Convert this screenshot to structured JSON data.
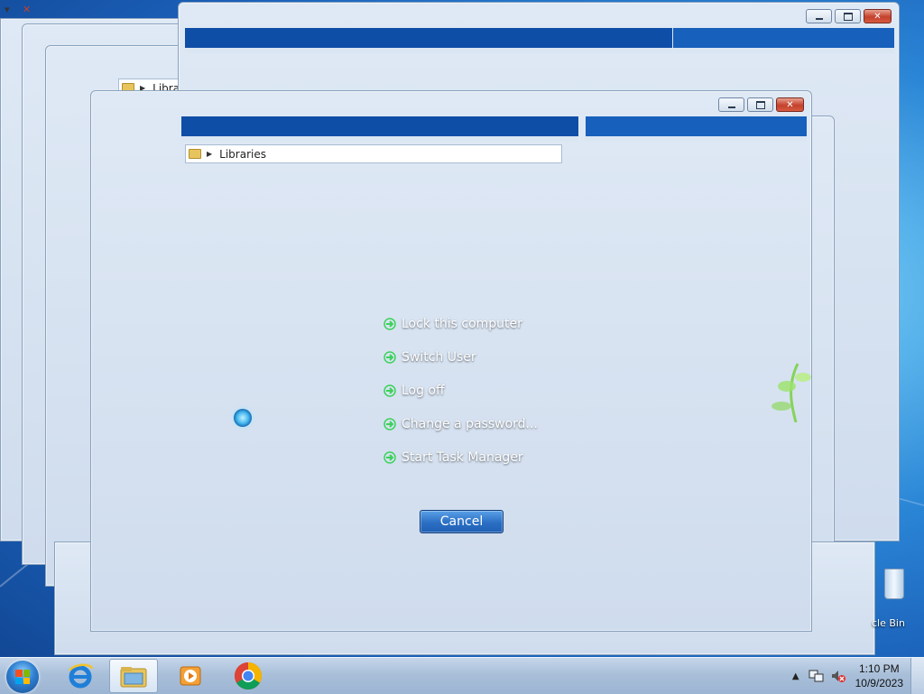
{
  "desktop": {
    "recycle_bin_label": "Recycle Bin",
    "recycle_bin_visible_label": "cle Bin"
  },
  "explorer": {
    "address_path": "Libraries",
    "address_path_partial": "Libra"
  },
  "ctrl_alt_del_menu": {
    "items": [
      {
        "label": "Lock this computer"
      },
      {
        "label": "Switch User"
      },
      {
        "label": "Log off"
      },
      {
        "label": "Change a password..."
      },
      {
        "label": "Start Task Manager"
      }
    ],
    "cancel_label": "Cancel"
  },
  "taskbar": {
    "pinned": [
      {
        "icon": "internet-explorer-icon"
      },
      {
        "icon": "windows-explorer-icon",
        "active": true
      },
      {
        "icon": "windows-media-player-icon"
      },
      {
        "icon": "chrome-icon"
      }
    ],
    "tray": {
      "time": "1:10 PM",
      "date": "10/9/2023"
    }
  },
  "colors": {
    "menu_arrow": "#3cd25a",
    "close_button": "#c4412c",
    "taskbar": "#a9bfd9"
  }
}
